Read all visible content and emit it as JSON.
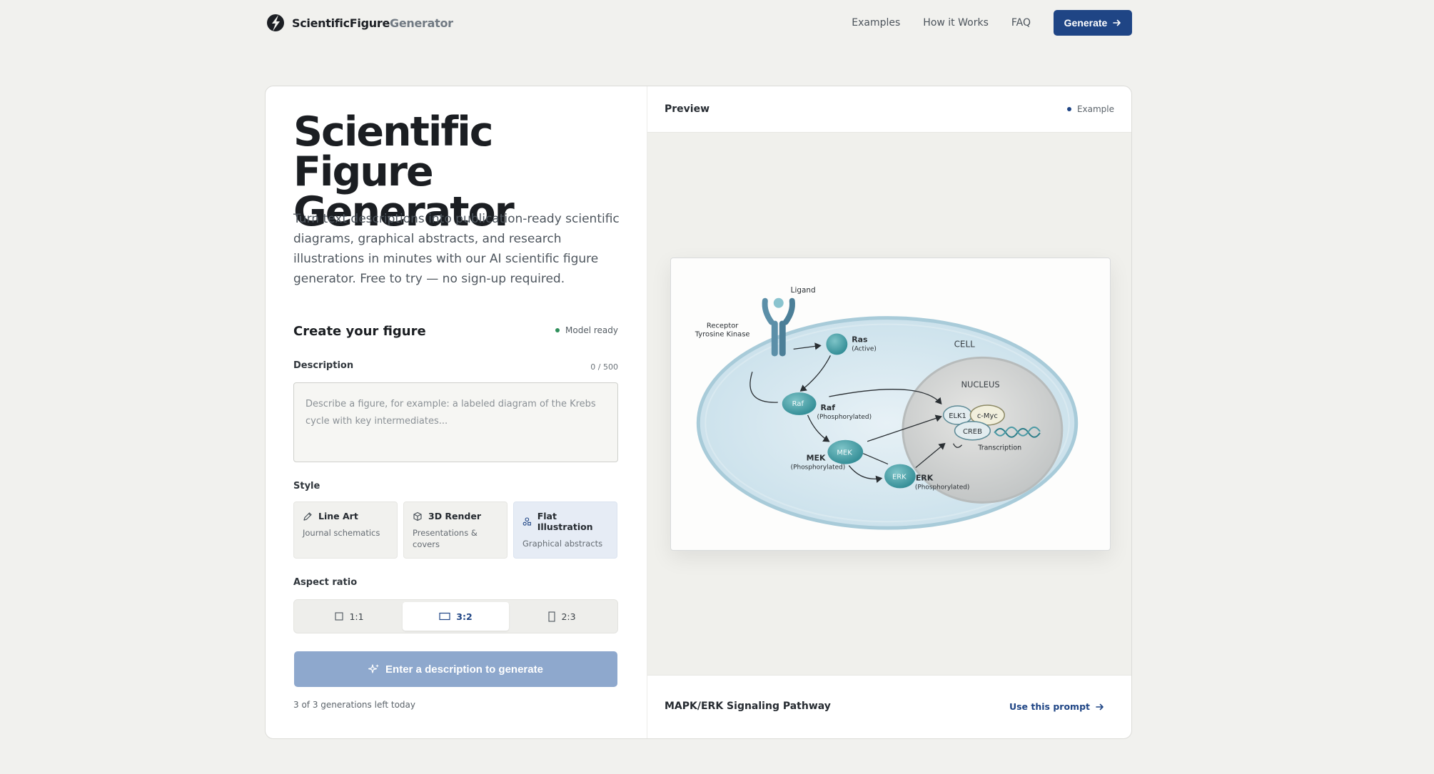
{
  "brand": {
    "name_bold": "ScientificFigure",
    "name_light": "Generator"
  },
  "nav": {
    "items": [
      "Examples",
      "How it Works",
      "FAQ"
    ],
    "generate": "Generate"
  },
  "hero": {
    "title": "Scientific Figure Generator",
    "lede": "Turn text descriptions into publication-ready scientific diagrams, graphical abstracts, and research illustrations in minutes with our AI scientific figure generator. Free to try — no sign-up required."
  },
  "form": {
    "title": "Create your figure",
    "status": "Model ready",
    "description_label": "Description",
    "counter": "0 / 500",
    "description_value": "",
    "placeholder": "Describe a figure, for example: a labeled diagram of the Krebs cycle with key intermediates...",
    "style_label": "Style",
    "styles": [
      {
        "name": "Line Art",
        "sub": "Journal schematics",
        "icon": "pen-icon"
      },
      {
        "name": "3D Render",
        "sub": "Presentations & covers",
        "icon": "cube-icon"
      },
      {
        "name": "Flat Illustration",
        "sub": "Graphical abstracts",
        "icon": "shapes-icon"
      }
    ],
    "selected_style": "Flat Illustration",
    "aspect_label": "Aspect ratio",
    "aspects": [
      "1:1",
      "3:2",
      "2:3"
    ],
    "selected_aspect": "3:2",
    "cta": "Enter a description to generate",
    "quota": "3 of 3 generations left today"
  },
  "preview": {
    "title": "Preview",
    "badge": "Example",
    "caption": "MAPK/ERK Signaling Pathway",
    "use_prompt": "Use this prompt",
    "figure_labels": {
      "ligand": "Ligand",
      "receptor_1": "Receptor",
      "receptor_2": "Tyrosine Kinase",
      "ras": "Ras",
      "ras_state": "(Active)",
      "raf_node": "Raf",
      "raf": "Raf",
      "raf_state": "(Phosphorylated)",
      "mek_node": "MEK",
      "mek": "MEK",
      "mek_state": "(Phosphorylated)",
      "erk_node": "ERK",
      "erk": "ERK",
      "erk_state": "(Phosphorylated)",
      "cell": "CELL",
      "nucleus": "NUCLEUS",
      "elk1": "ELK1",
      "cmyc": "c-Myc",
      "creb": "CREB",
      "transcription": "Transcription"
    }
  },
  "colors": {
    "accent": "#1f4585",
    "cta_disabled": "#8ea8cd",
    "ready": "#2f8f5b",
    "selected_bg": "#e6ecf5"
  }
}
